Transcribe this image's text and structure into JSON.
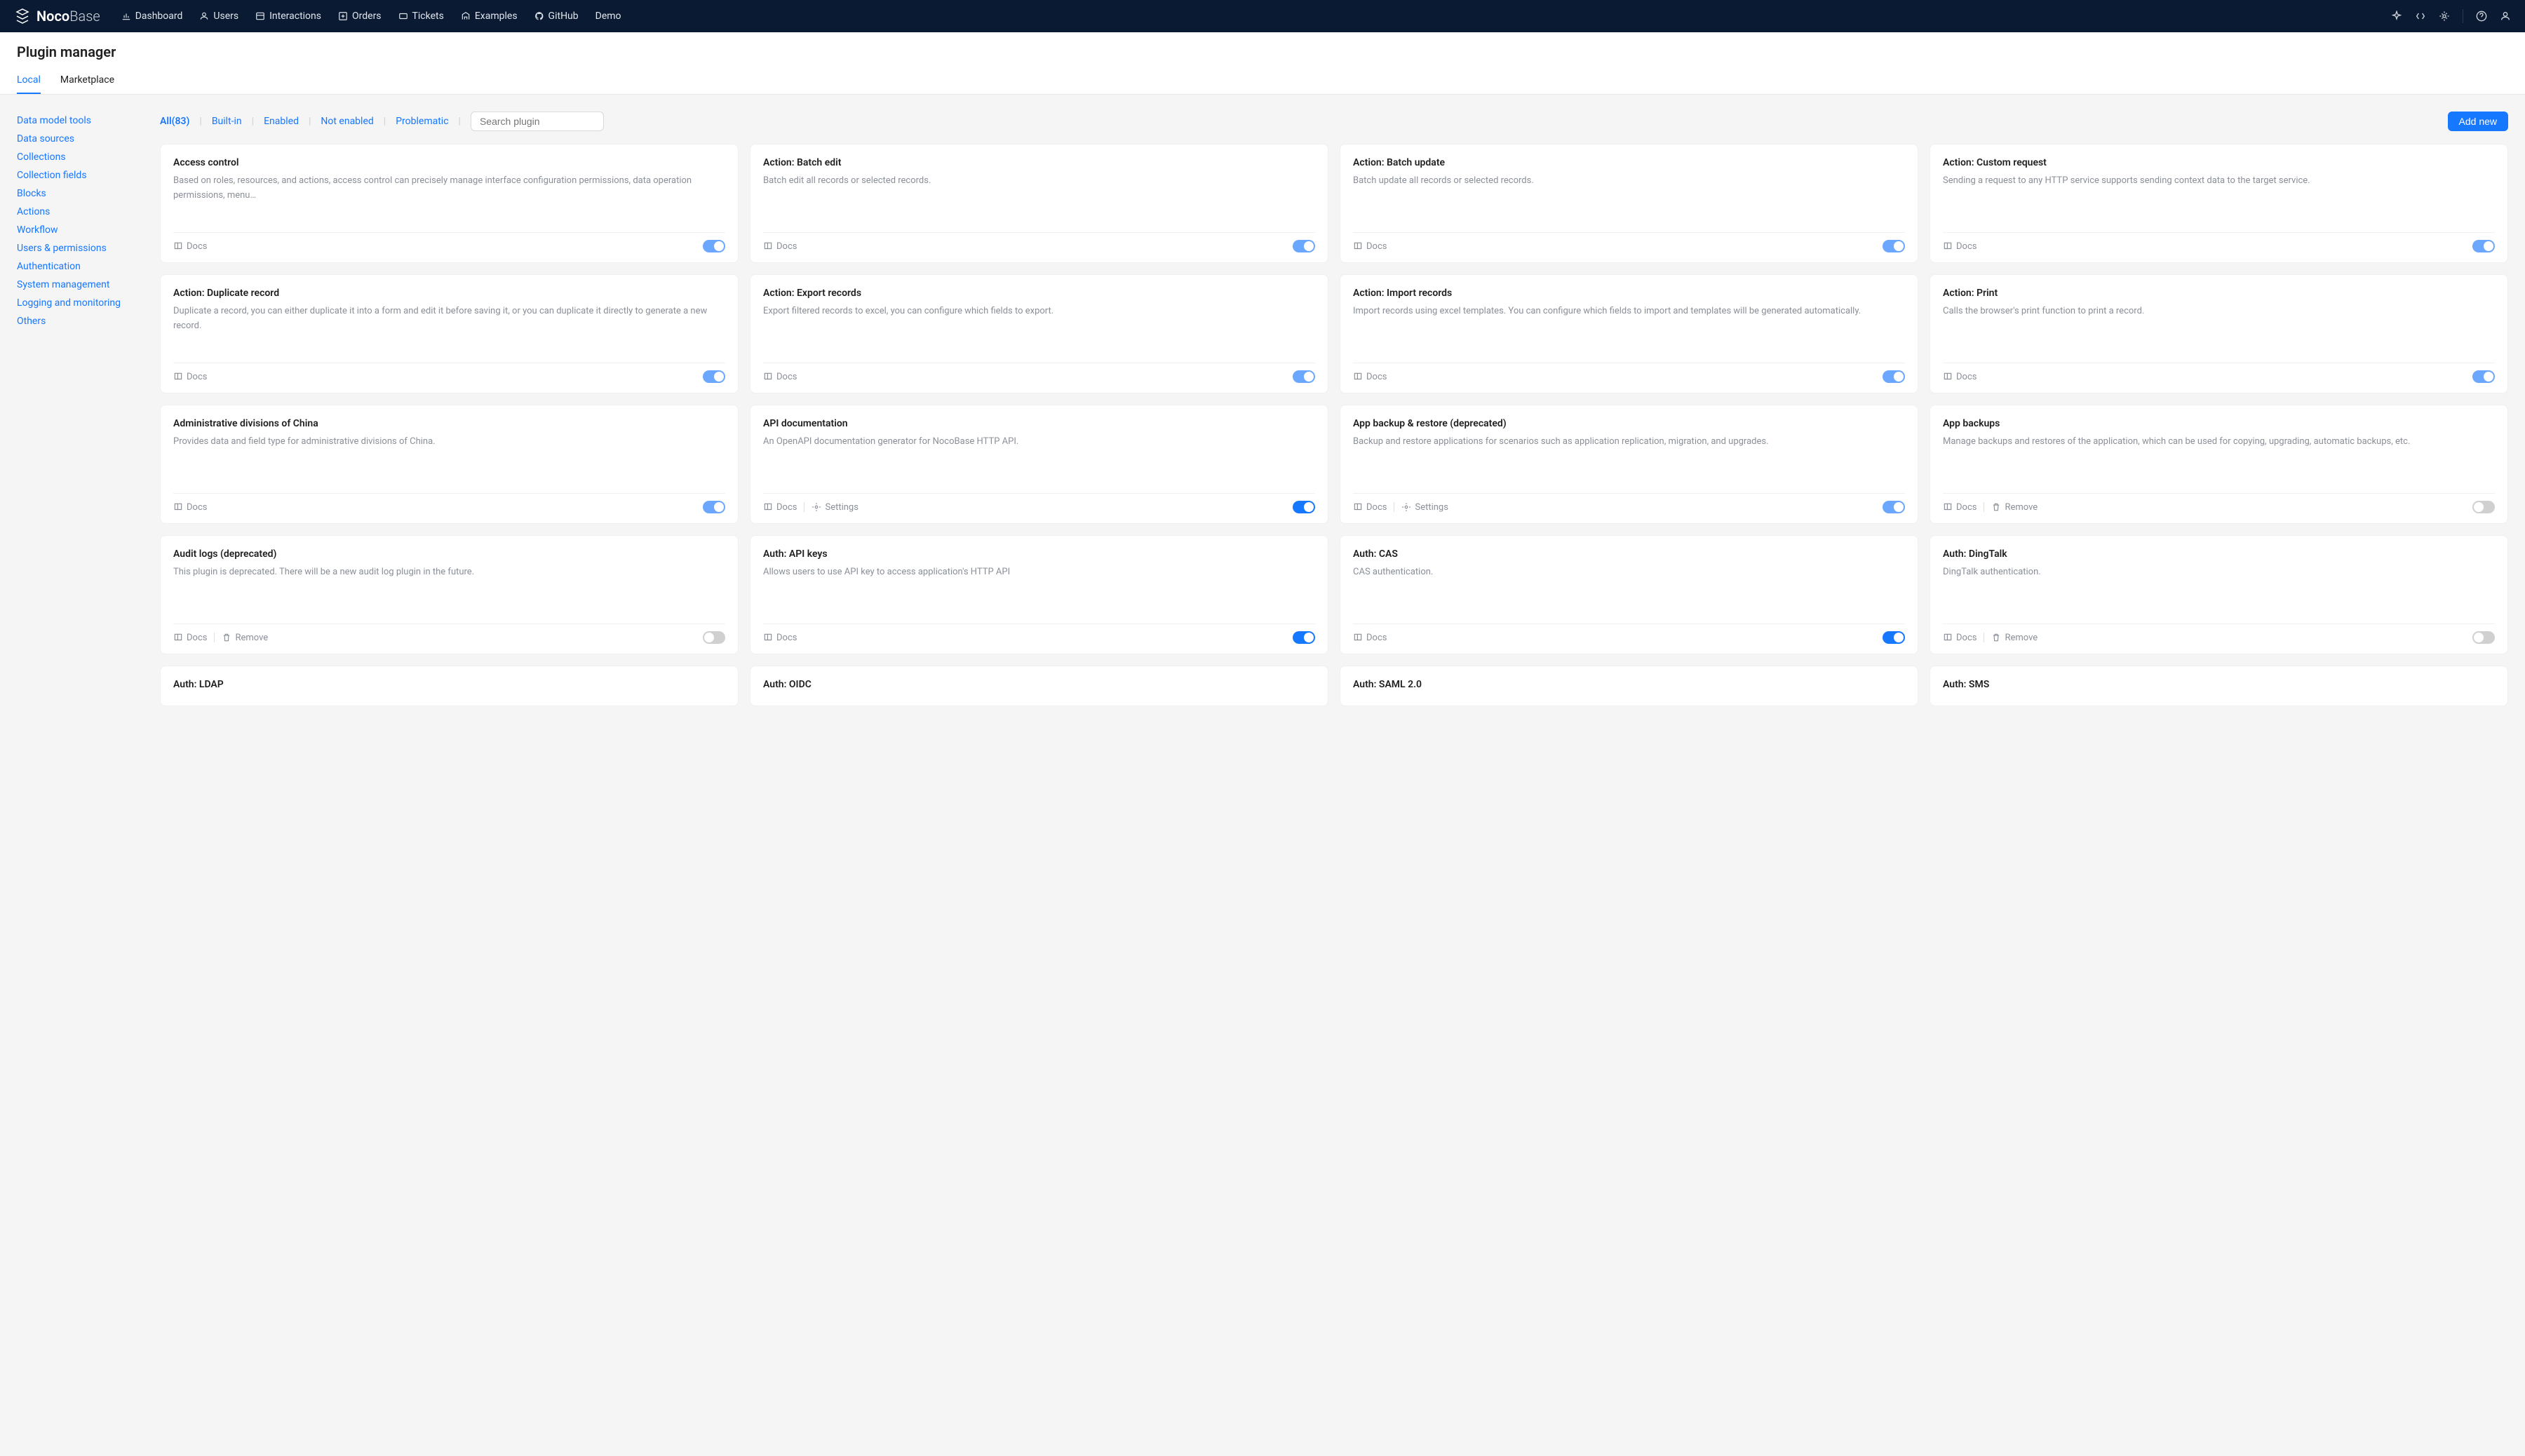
{
  "logo": {
    "bold": "Noco",
    "light": "Base"
  },
  "nav": {
    "dashboard": "Dashboard",
    "users": "Users",
    "interactions": "Interactions",
    "orders": "Orders",
    "tickets": "Tickets",
    "examples": "Examples",
    "github": "GitHub",
    "demo": "Demo"
  },
  "page_title": "Plugin manager",
  "tabs": {
    "local": "Local",
    "marketplace": "Marketplace"
  },
  "sidebar": {
    "s0": "Data model tools",
    "s1": "Data sources",
    "s2": "Collections",
    "s3": "Collection fields",
    "s4": "Blocks",
    "s5": "Actions",
    "s6": "Workflow",
    "s7": "Users & permissions",
    "s8": "Authentication",
    "s9": "System management",
    "s10": "Logging and monitoring",
    "s11": "Others"
  },
  "filters": {
    "all": "All(83)",
    "builtin": "Built-in",
    "enabled": "Enabled",
    "not_enabled": "Not enabled",
    "problematic": "Problematic",
    "search_placeholder": "Search plugin"
  },
  "add_new": "Add new",
  "labels": {
    "docs": "Docs",
    "settings": "Settings",
    "remove": "Remove"
  },
  "plugins": [
    {
      "title": "Access control",
      "desc": "Based on roles, resources, and actions, access control can precisely manage interface configuration permissions, data operation permissions, menu…",
      "docs": true,
      "toggle": "on-alt"
    },
    {
      "title": "Action: Batch edit",
      "desc": "Batch edit all records or selected records.",
      "docs": true,
      "toggle": "on-alt"
    },
    {
      "title": "Action: Batch update",
      "desc": "Batch update all records or selected records.",
      "docs": true,
      "toggle": "on-alt"
    },
    {
      "title": "Action: Custom request",
      "desc": "Sending a request to any HTTP service supports sending context data to the target service.",
      "docs": true,
      "toggle": "on-alt"
    },
    {
      "title": "Action: Duplicate record",
      "desc": "Duplicate a record, you can either duplicate it into a form and edit it before saving it, or you can duplicate it directly to generate a new record.",
      "docs": true,
      "toggle": "on-alt"
    },
    {
      "title": "Action: Export records",
      "desc": "Export filtered records to excel, you can configure which fields to export.",
      "docs": true,
      "toggle": "on-alt"
    },
    {
      "title": "Action: Import records",
      "desc": "Import records using excel templates. You can configure which fields to import and templates will be generated automatically.",
      "docs": true,
      "toggle": "on-alt"
    },
    {
      "title": "Action: Print",
      "desc": "Calls the browser's print function to print a record.",
      "docs": true,
      "toggle": "on-alt"
    },
    {
      "title": "Administrative divisions of China",
      "desc": "Provides data and field type for administrative divisions of China.",
      "docs": true,
      "toggle": "on-alt"
    },
    {
      "title": "API documentation",
      "desc": "An OpenAPI documentation generator for NocoBase HTTP API.",
      "docs": true,
      "settings": true,
      "toggle": "on"
    },
    {
      "title": "App backup & restore (deprecated)",
      "desc": "Backup and restore applications for scenarios such as application replication, migration, and upgrades.",
      "docs": true,
      "settings": true,
      "toggle": "on-alt"
    },
    {
      "title": "App backups",
      "desc": "Manage backups and restores of the application, which can be used for copying, upgrading, automatic backups, etc.",
      "docs": true,
      "remove": true,
      "toggle": "off"
    },
    {
      "title": "Audit logs (deprecated)",
      "desc": "This plugin is deprecated. There will be a new audit log plugin in the future.",
      "docs": true,
      "remove": true,
      "toggle": "off"
    },
    {
      "title": "Auth: API keys",
      "desc": "Allows users to use API key to access application's HTTP API",
      "docs": true,
      "toggle": "on"
    },
    {
      "title": "Auth: CAS",
      "desc": "CAS authentication.",
      "docs": true,
      "toggle": "on"
    },
    {
      "title": "Auth: DingTalk",
      "desc": "DingTalk authentication.",
      "docs": true,
      "remove": true,
      "toggle": "off"
    },
    {
      "title": "Auth: LDAP",
      "desc": "",
      "docs": false,
      "short": true
    },
    {
      "title": "Auth: OIDC",
      "desc": "",
      "docs": false,
      "short": true
    },
    {
      "title": "Auth: SAML 2.0",
      "desc": "",
      "docs": false,
      "short": true
    },
    {
      "title": "Auth: SMS",
      "desc": "",
      "docs": false,
      "short": true
    }
  ]
}
